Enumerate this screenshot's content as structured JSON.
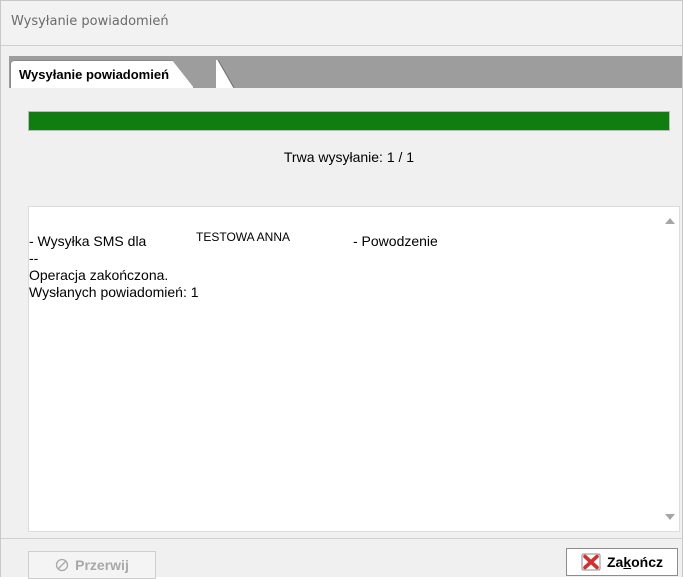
{
  "window": {
    "title": "Wysyłanie powiadomień"
  },
  "tabs": [
    {
      "label": "Wysyłanie powiadomień"
    }
  ],
  "progress": {
    "fraction": 1.0,
    "status_text": "Trwa wysyłanie: 1 / 1",
    "fill_color": "#0f7d0f"
  },
  "log": {
    "rows": [
      {
        "prefix": "- Wysyłka SMS dla",
        "recipient": "TESTOWA ANNA",
        "result": "- Powodzenie"
      },
      {
        "prefix": "--"
      },
      {
        "prefix": "Operacja zakończona."
      },
      {
        "prefix": "Wysłanych powiadomień: 1"
      }
    ]
  },
  "buttons": {
    "stop": {
      "label": "Przerwij",
      "icon": "cancel-circle-icon",
      "enabled": false
    },
    "finish": {
      "label_before": "Za",
      "label_mnemonic": "k",
      "label_after": "ończ",
      "icon": "red-x-icon"
    }
  },
  "colors": {
    "accent_red": "#d32f2f",
    "progress_green": "#0f7d0f"
  }
}
